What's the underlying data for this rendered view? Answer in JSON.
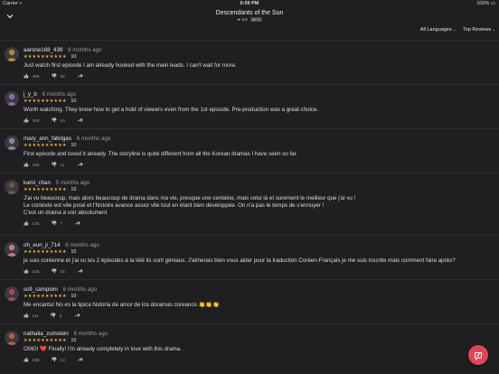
{
  "status_bar": {
    "carrier": "Carrier ▿",
    "time": "6:09 PM",
    "battery": "100% ▭"
  },
  "nav": {
    "title": "Descendants of the Sun",
    "rating": "9.8",
    "count": "8174",
    "back_icon": "chevron-down-icon"
  },
  "filters": [
    {
      "label": "All Languages"
    },
    {
      "label": "Top Reviews"
    }
  ],
  "reviews": [
    {
      "user": "aarone168_439",
      "time": "6 months ago",
      "rating": "10",
      "text": [
        "Just watch first episode I am already hooked with the main leads. I can't wait for more."
      ],
      "likes": "466",
      "dislikes": "25",
      "avatar_color": "#b08a3a"
    },
    {
      "user": "j_y_b",
      "time": "6 months ago",
      "rating": "10",
      "text": [
        "Worth watching. They know how to get a hold of viewers even from the 1st episode. Pre-production was a great choice."
      ],
      "likes": "304",
      "dislikes": "19",
      "avatar_color": "#8a6aa8"
    },
    {
      "user": "mary_ann_fabrigas",
      "time": "6 months ago",
      "rating": "10",
      "text": [
        "First episode and loved it already.  The storyline is quite different from all the Korean dramas I have seen so far."
      ],
      "likes": "184",
      "dislikes": "11",
      "avatar_color": "#7a8aa0"
    },
    {
      "user": "kami_chan",
      "time": "5 months ago",
      "rating": "10",
      "text": [
        "J'ai vu beaucoup, mais alors beaucoup de drama dans ma vie, presque une centaine, mais celui là et surement le meilleur que j'ai vu !",
        "Le contexte est vite posé et l'histoire avance assez vite tout en étant bien développée. On n'a pas le temps de s'ennuyer !",
        "C'est un drama à voir absolument"
      ],
      "likes": "125",
      "dislikes": "7",
      "avatar_color": "#6a5a48"
    },
    {
      "user": "oh_eun_ji_714",
      "time": "6 months ago",
      "rating": "10",
      "text": [
        "je suis coréenne et j'ai vu les 2 épisodes à la télé ils sont géniaux. J'aimerais bien vous aider pour la traduction Coréen-Français je me suis inscrite mais comment faire après?"
      ],
      "likes": "225",
      "dislikes": "15",
      "avatar_color": "#c07a8a"
    },
    {
      "user": "sofi_campioni",
      "time": "6 months ago",
      "rating": "10",
      "text": [
        "Me encanta! No es la tipica historia de amor de los doramas coreanos 👏👏👏"
      ],
      "likes": "111",
      "dislikes": "6",
      "avatar_color": "#a04a5a"
    },
    {
      "user": "nathalia_zumstein",
      "time": "6 months ago",
      "rating": "10",
      "text": [
        "OMG! ❤️ Finally! I'm already completely in love with this drama."
      ],
      "likes": "198",
      "dislikes": "13",
      "avatar_color": "#b05a4a"
    }
  ],
  "stars": "★★★★★★★★★★",
  "icons": {
    "like": "thumbs-up-icon",
    "dislike": "thumbs-down-icon",
    "share": "share-icon",
    "compose": "compose-icon"
  },
  "colors": {
    "accent": "#e0455a",
    "star": "#f0b23a",
    "background": "#1f1f21"
  }
}
